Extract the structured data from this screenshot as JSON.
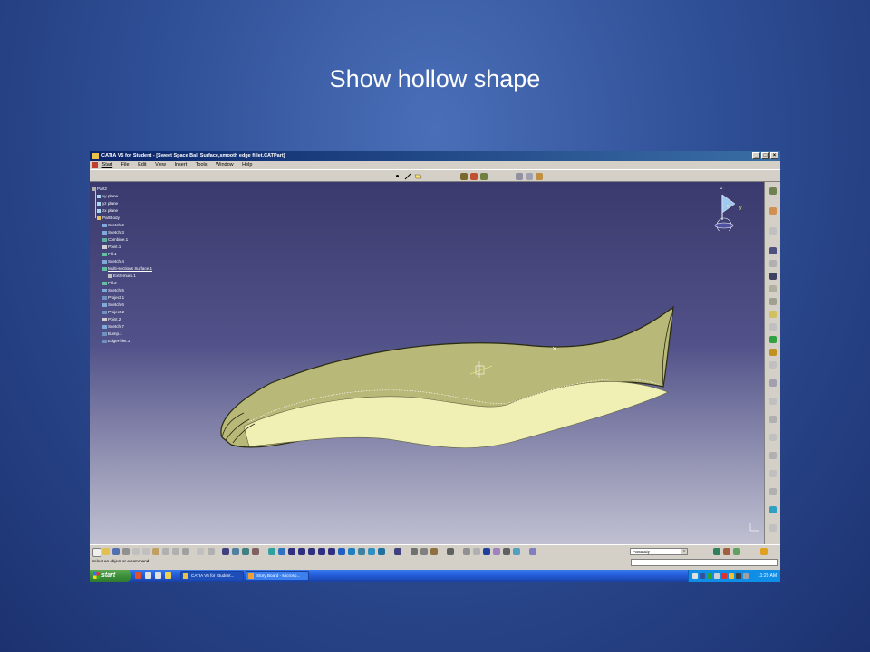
{
  "slide": {
    "title": "Show hollow shape"
  },
  "window": {
    "title": "CATIA V5 for Student - [Sweet Space Ball Surface,smooth edge fillet.CATPart]",
    "controls": [
      "_",
      "□",
      "×"
    ]
  },
  "menu": {
    "items": [
      "Start",
      "File",
      "Edit",
      "View",
      "Insert",
      "Tools",
      "Window",
      "Help"
    ]
  },
  "tree": {
    "items": [
      "Part2",
      "xy plane",
      "yz plane",
      "zx plane",
      "PartBody",
      "Sketch.2",
      "Sketch.3",
      "Combine.1",
      "Point.1",
      "Fill.1",
      "Sketch.4",
      "Multi-sections Surface.1",
      "Extremum.1",
      "Fill.2",
      "Sketch.5",
      "Project.1",
      "Sketch.6",
      "Project.2",
      "Point.2",
      "Sketch.7",
      "Bump.1",
      "EdgeFillet.1"
    ]
  },
  "compass": {
    "z": "z",
    "x": "x",
    "y": "y"
  },
  "toolbar": {
    "part_select": "PartBody"
  },
  "status": {
    "prompt": "Select an object or a command"
  },
  "taskbar": {
    "start_label": "start",
    "tasks": [
      "CATIA V5 for Student...",
      "Story Board - Microso..."
    ],
    "clock": "11:29 AM"
  },
  "colors": {
    "surface_fill": "#b8b878",
    "surface_inner": "#f0f0b4",
    "viewport_top": "#3a3a6e",
    "viewport_bottom": "#c0c0d2",
    "slide_background": "#2f4f96"
  }
}
